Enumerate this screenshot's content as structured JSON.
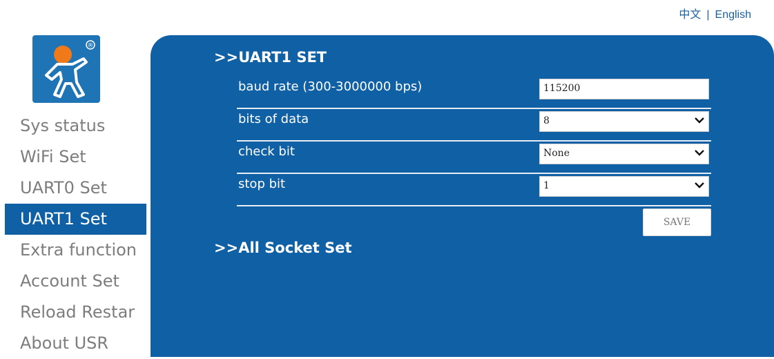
{
  "header": {
    "lang_cn": "中文",
    "lang_sep": "|",
    "lang_en": "English"
  },
  "logo": {
    "icon": "usr-running-man-logo",
    "mark": "®"
  },
  "sidebar": {
    "items": [
      {
        "label": "Sys status",
        "active": false
      },
      {
        "label": "WiFi Set",
        "active": false
      },
      {
        "label": "UART0 Set",
        "active": false
      },
      {
        "label": "UART1 Set",
        "active": true
      },
      {
        "label": "Extra function",
        "active": false
      },
      {
        "label": "Account Set",
        "active": false
      },
      {
        "label": "Reload Restar",
        "active": false
      },
      {
        "label": "About USR",
        "active": false
      }
    ]
  },
  "main": {
    "uart_section_title": ">>UART1 SET",
    "fields": {
      "baud_rate": {
        "label": "baud rate (300-3000000 bps)",
        "value": "115200"
      },
      "data_bits": {
        "label": "bits of data",
        "value": "8"
      },
      "check_bit": {
        "label": "check bit",
        "value": "None"
      },
      "stop_bit": {
        "label": "stop bit",
        "value": "1"
      }
    },
    "save_label": "SAVE",
    "socket_section_title": ">>All Socket Set"
  },
  "colors": {
    "accent": "#0f60a4",
    "sidebar_text": "#7d7d7d",
    "link": "#1b5f9e",
    "logo_bg": "#1f74b5",
    "logo_head": "#f07a1a"
  }
}
